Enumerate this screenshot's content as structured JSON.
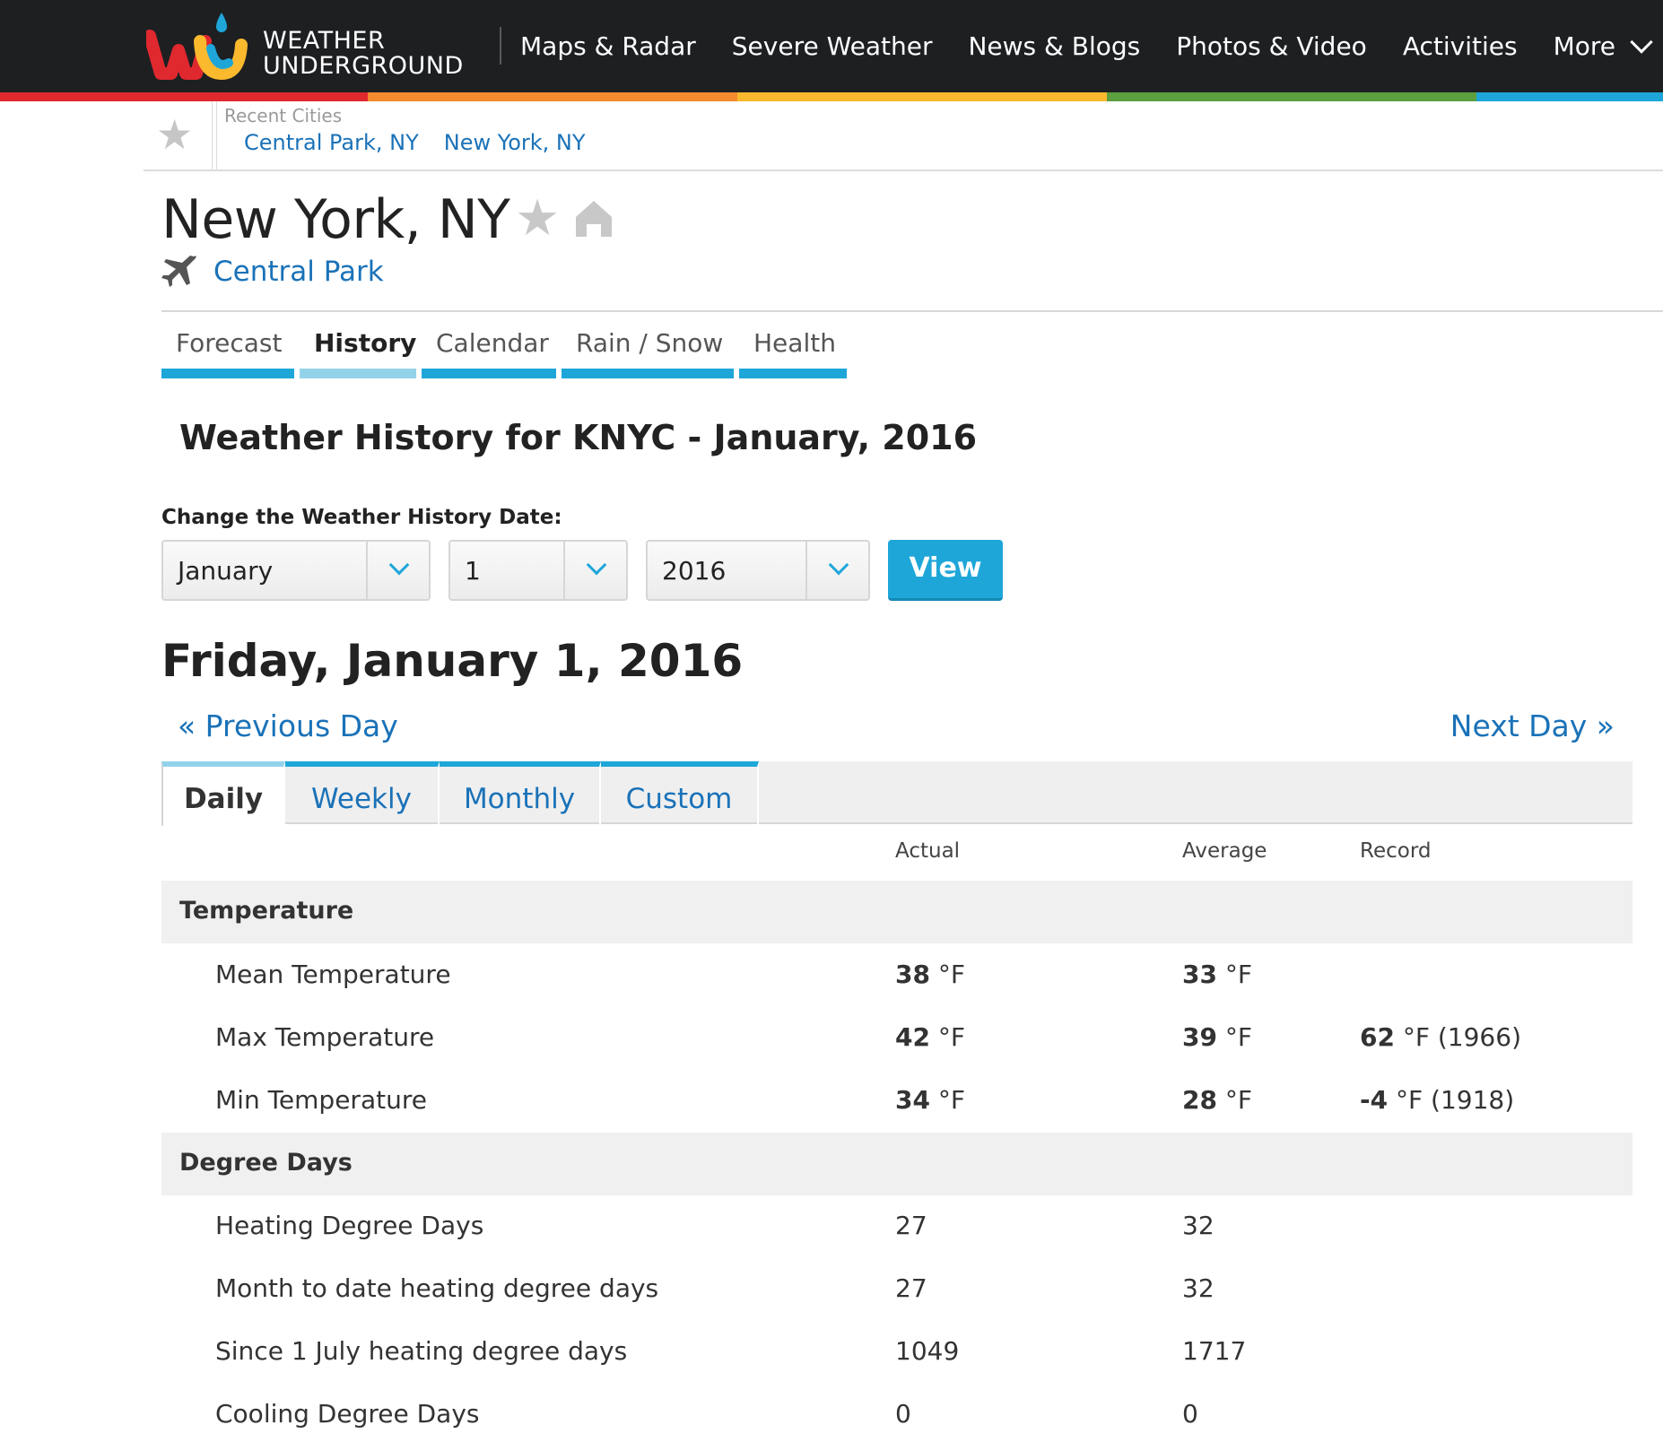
{
  "nav": {
    "logo_line1": "WEATHER",
    "logo_line2": "UNDERGROUND",
    "items": [
      "Maps & Radar",
      "Severe Weather",
      "News & Blogs",
      "Photos & Video",
      "Activities"
    ],
    "more_label": "More"
  },
  "colors": {
    "nav_bg": "#1d1f21",
    "accent_blue": "#1ea6d9",
    "link_blue": "#1a72b8",
    "rainbow": [
      "#e0282f",
      "#f58a2f",
      "#fbb92e",
      "#5b9f3f",
      "#1ea6d9"
    ]
  },
  "recent": {
    "label": "Recent Cities",
    "cities": [
      "Central Park, NY",
      "New York, NY"
    ]
  },
  "city": {
    "title": "New York, NY",
    "station": "Central Park"
  },
  "city_tabs": [
    "Forecast",
    "History",
    "Calendar",
    "Rain / Snow",
    "Health"
  ],
  "active_city_tab": "History",
  "history_title": "Weather History for KNYC - January, 2016",
  "date_picker": {
    "label": "Change the Weather History Date:",
    "month": "January",
    "day": "1",
    "year": "2016",
    "view_label": "View"
  },
  "day_title": "Friday, January 1, 2016",
  "prev_day": "« Previous Day",
  "next_day": "Next Day »",
  "period_tabs": [
    "Daily",
    "Weekly",
    "Monthly",
    "Custom"
  ],
  "active_period_tab": "Daily",
  "table": {
    "headers": {
      "actual": "Actual",
      "average": "Average",
      "record": "Record"
    },
    "sections": [
      {
        "title": "Temperature",
        "rows": [
          {
            "label": "Mean Temperature",
            "actual": "38",
            "actual_unit": "°F",
            "average": "33",
            "average_unit": "°F",
            "record": "",
            "record_unit": ""
          },
          {
            "label": "Max Temperature",
            "actual": "42",
            "actual_unit": "°F",
            "average": "39",
            "average_unit": "°F",
            "record": "62",
            "record_unit": "°F (1966)"
          },
          {
            "label": "Min Temperature",
            "actual": "34",
            "actual_unit": "°F",
            "average": "28",
            "average_unit": "°F",
            "record": "-4",
            "record_unit": "°F (1918)"
          }
        ]
      },
      {
        "title": "Degree Days",
        "rows": [
          {
            "label": "Heating Degree Days",
            "actual": "27",
            "average": "32",
            "record": ""
          },
          {
            "label": "Month to date heating degree days",
            "actual": "27",
            "average": "32",
            "record": ""
          },
          {
            "label": "Since 1 July heating degree days",
            "actual": "1049",
            "average": "1717",
            "record": ""
          },
          {
            "label": "Cooling Degree Days",
            "actual": "0",
            "average": "0",
            "record": ""
          }
        ]
      }
    ]
  }
}
